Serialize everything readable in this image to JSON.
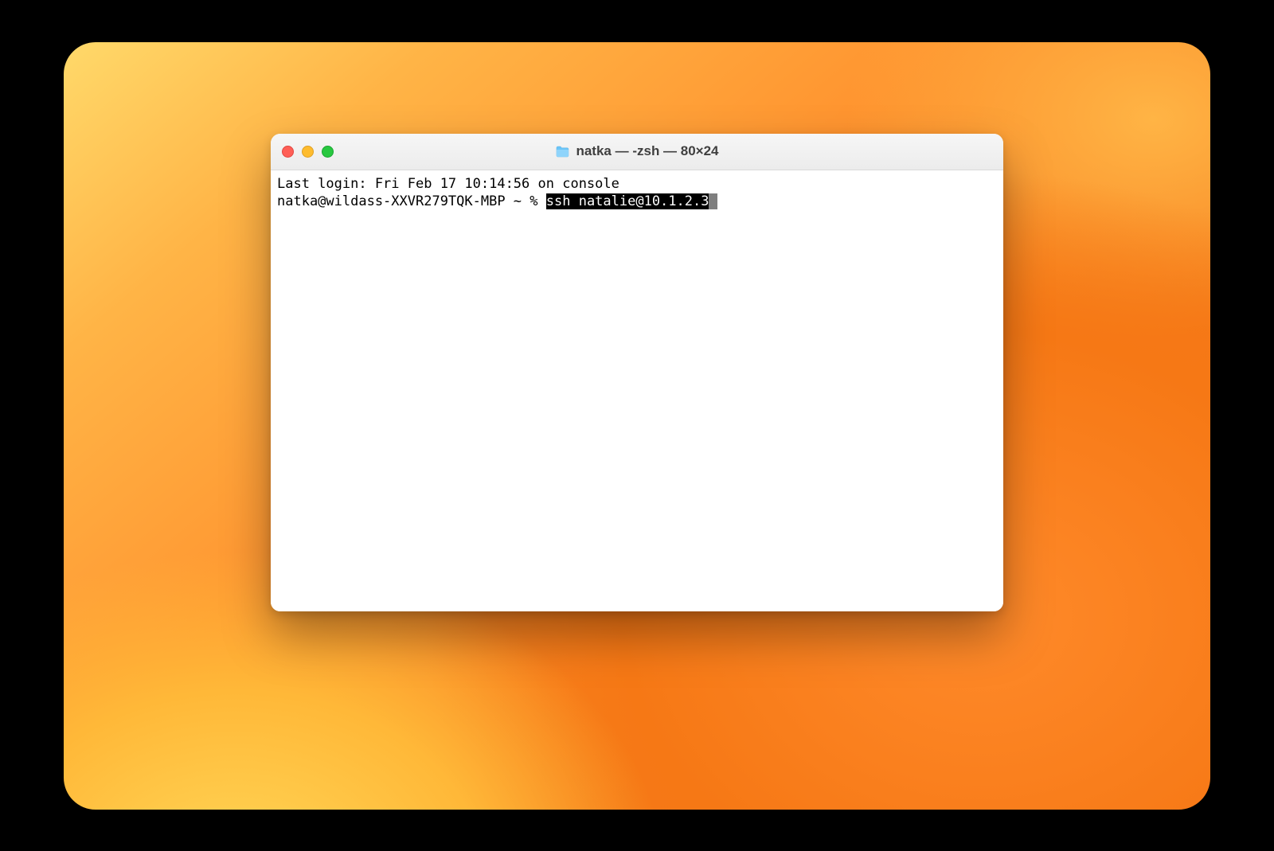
{
  "window": {
    "title": "natka — -zsh — 80×24",
    "icon": "folder-icon"
  },
  "terminal": {
    "last_login": "Last login: Fri Feb 17 10:14:56 on console",
    "prompt": "natka@wildass-XXVR279TQK-MBP ~ % ",
    "command_selected": "ssh natalie@10.1.2.3"
  }
}
